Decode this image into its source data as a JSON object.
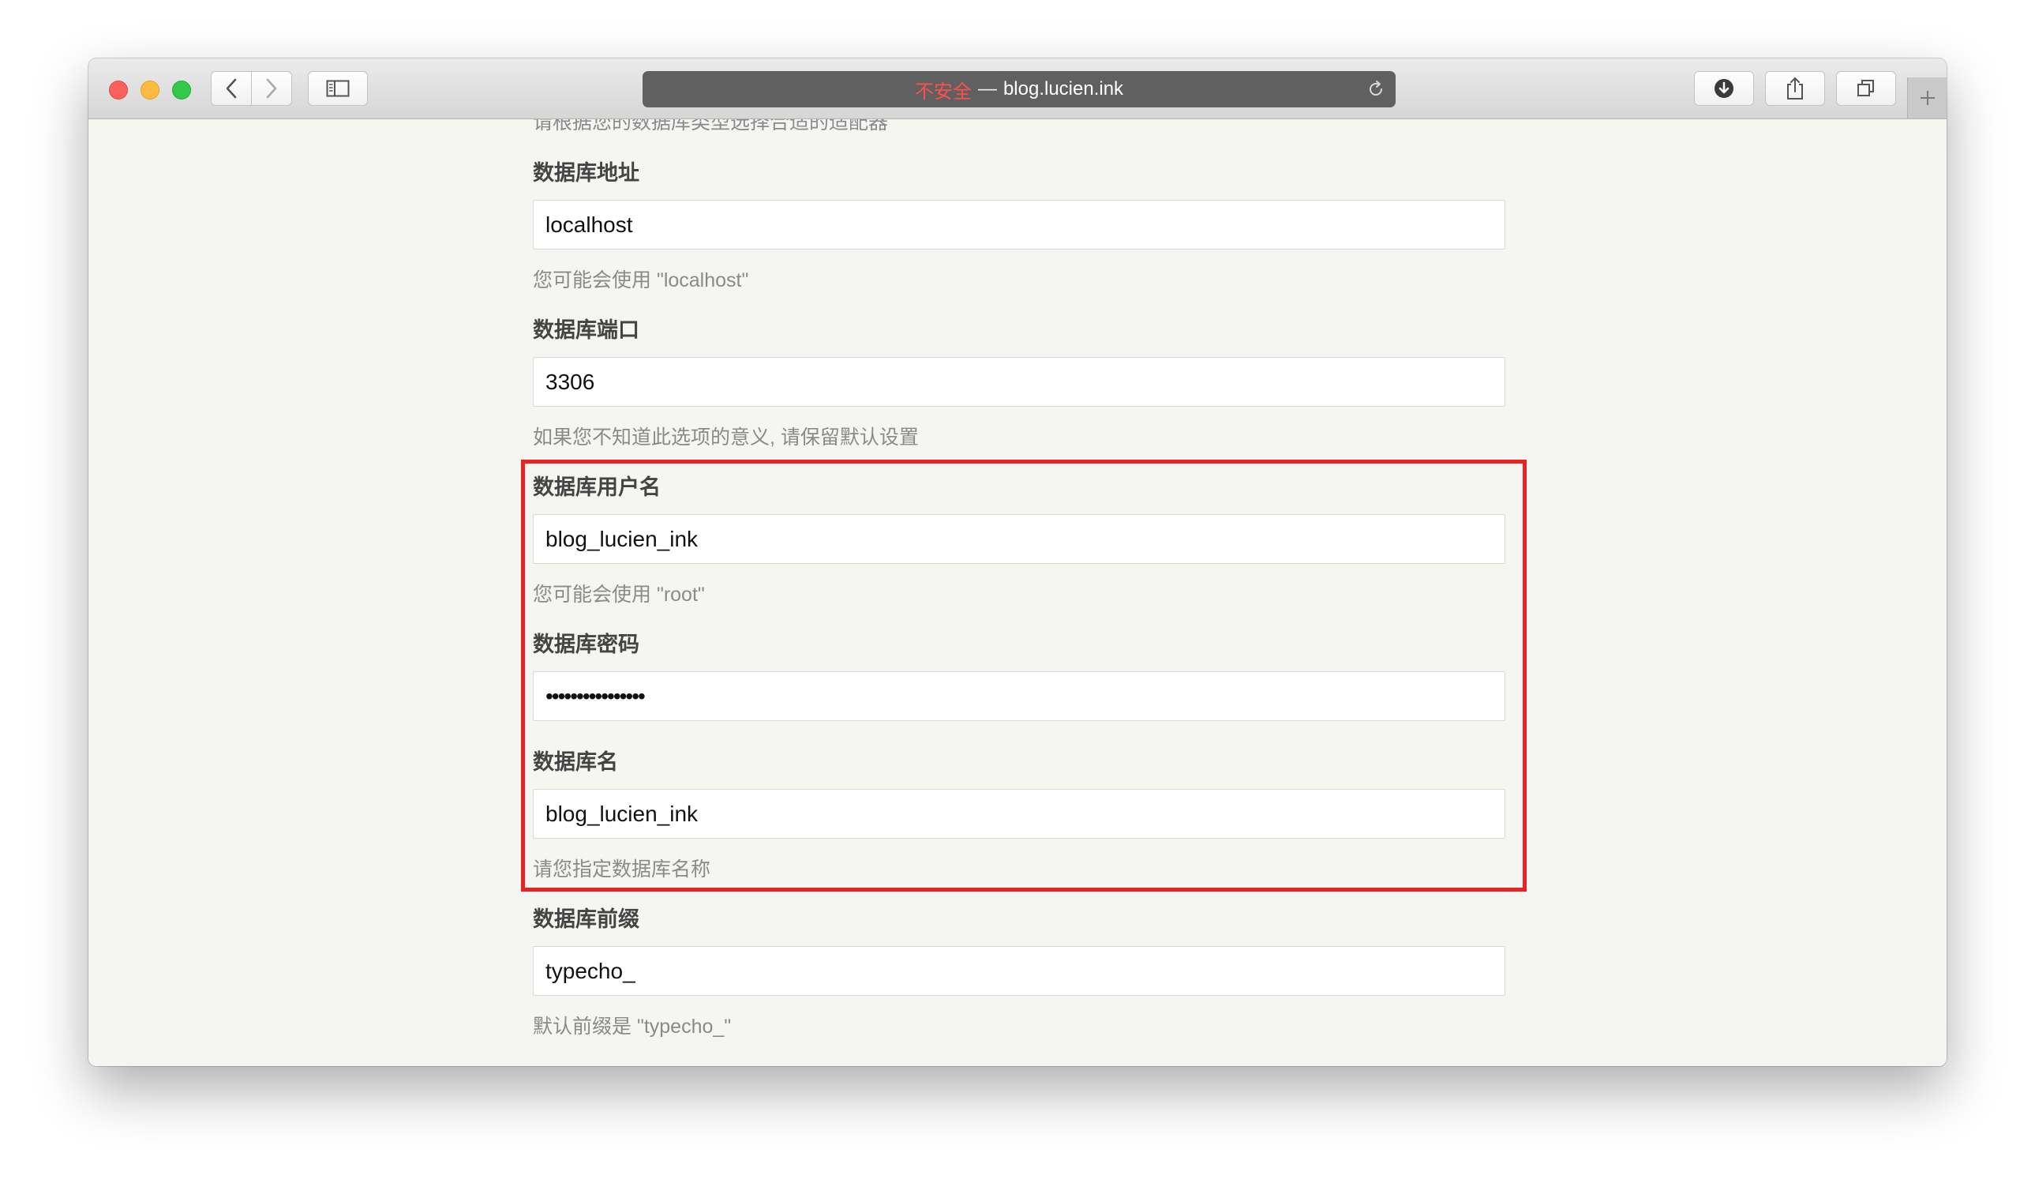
{
  "browser": {
    "address": {
      "insecure_label": "不安全",
      "separator": "—",
      "host": "blog.lucien.ink"
    },
    "colors": {
      "insecure": "#ff4f4a",
      "highlight": "#ec2222"
    },
    "icons": {
      "back": "chevron-left-icon",
      "forward": "chevron-right-icon",
      "sidebar": "sidebar-icon",
      "reload": "reload-icon",
      "download": "download-icon",
      "share": "share-icon",
      "tabs": "tabs-overview-icon",
      "new_tab": "plus-icon"
    }
  },
  "form": {
    "cut_description": "请根据您的数据库类型选择合适的适配器",
    "fields": [
      {
        "label": "数据库地址",
        "value": "localhost",
        "help": "您可能会使用 \"localhost\""
      },
      {
        "label": "数据库端口",
        "value": "3306",
        "help": "如果您不知道此选项的意义, 请保留默认设置"
      },
      {
        "label": "数据库用户名",
        "value": "blog_lucien_ink",
        "help": "您可能会使用 \"root\""
      },
      {
        "label": "数据库密码",
        "value": "••••••••••••••••",
        "help": ""
      },
      {
        "label": "数据库名",
        "value": "blog_lucien_ink",
        "help": "请您指定数据库名称"
      },
      {
        "label": "数据库前缀",
        "value": "typecho_",
        "help": "默认前缀是 \"typecho_\""
      }
    ]
  }
}
